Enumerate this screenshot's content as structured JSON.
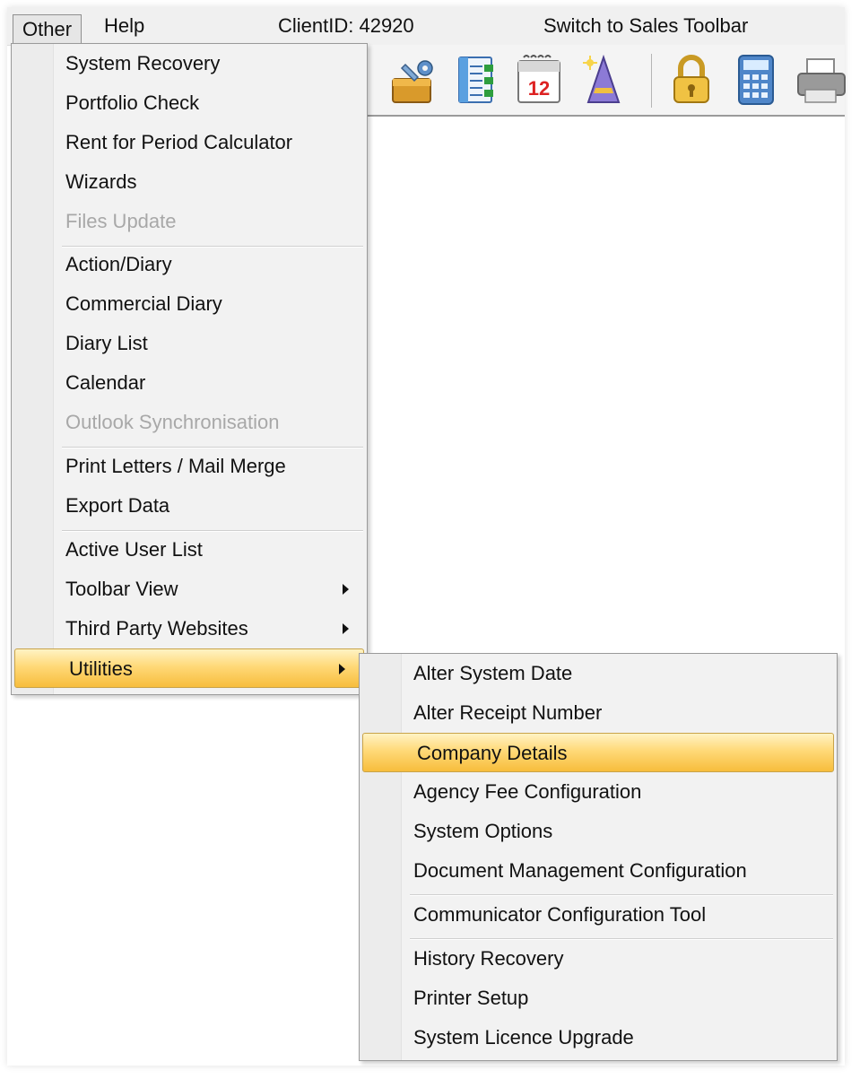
{
  "menubar": {
    "other": "Other",
    "help": "Help",
    "client_id": "ClientID: 42920",
    "switch_toolbar": "Switch to Sales Toolbar"
  },
  "toolbar": {
    "icons": [
      "toolbox-icon",
      "list-icon",
      "calendar-icon",
      "wizard-icon",
      "lock-icon",
      "calculator-icon",
      "printer-icon"
    ],
    "calendar_day": "12"
  },
  "other_menu": {
    "items": [
      {
        "label": "System Recovery",
        "disabled": false
      },
      {
        "label": "Portfolio Check",
        "disabled": false
      },
      {
        "label": "Rent for Period Calculator",
        "disabled": false
      },
      {
        "label": "Wizards",
        "disabled": false
      },
      {
        "label": "Files Update",
        "disabled": true
      },
      {
        "label": "Action/Diary",
        "disabled": false
      },
      {
        "label": "Commercial Diary",
        "disabled": false
      },
      {
        "label": "Diary List",
        "disabled": false
      },
      {
        "label": "Calendar",
        "disabled": false
      },
      {
        "label": "Outlook Synchronisation",
        "disabled": true
      },
      {
        "label": "Print Letters / Mail Merge",
        "disabled": false
      },
      {
        "label": "Export Data",
        "disabled": false
      },
      {
        "label": "Active User List",
        "disabled": false
      },
      {
        "label": "Toolbar View",
        "disabled": false,
        "submenu": true
      },
      {
        "label": "Third Party Websites",
        "disabled": false,
        "submenu": true
      },
      {
        "label": "Utilities",
        "disabled": false,
        "submenu": true,
        "highlighted": true
      }
    ]
  },
  "utilities_menu": {
    "items": [
      {
        "label": "Alter System Date"
      },
      {
        "label": "Alter Receipt Number"
      },
      {
        "label": "Company Details",
        "highlighted": true
      },
      {
        "label": "Agency Fee Configuration"
      },
      {
        "label": "System Options"
      },
      {
        "label": "Document Management Configuration"
      },
      {
        "label": "Communicator Configuration Tool"
      },
      {
        "label": "History Recovery"
      },
      {
        "label": "Printer Setup"
      },
      {
        "label": "System Licence Upgrade"
      }
    ]
  },
  "colors": {
    "highlight_top": "#fff3c4",
    "highlight_bottom": "#f7bd3c",
    "highlight_border": "#c8a34a",
    "disabled_text": "#a8a8a8"
  }
}
